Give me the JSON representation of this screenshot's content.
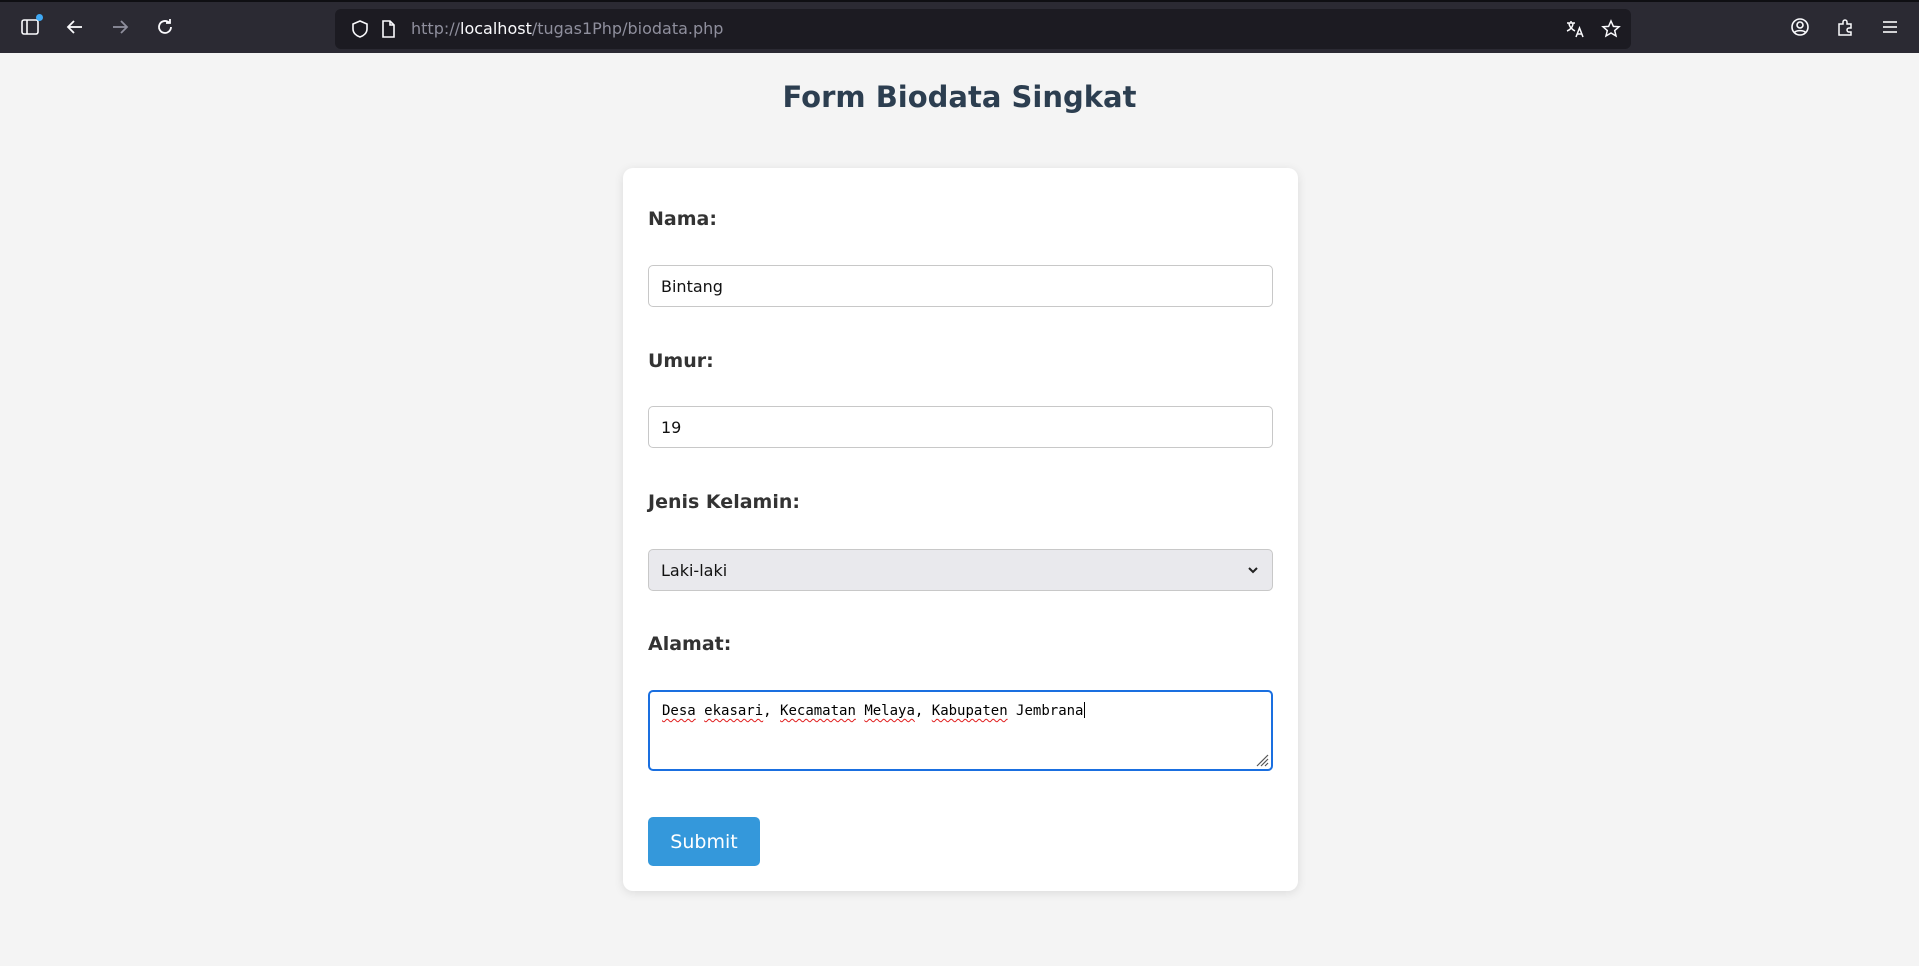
{
  "browser": {
    "url_prefix": "http://",
    "url_host": "localhost",
    "url_path": "/tugas1Php/biodata.php"
  },
  "page": {
    "title": "Form Biodata Singkat"
  },
  "form": {
    "nama_label": "Nama:",
    "nama_value": "Bintang",
    "umur_label": "Umur:",
    "umur_value": "19",
    "jk_label": "Jenis Kelamin:",
    "jk_value": "Laki-laki",
    "alamat_label": "Alamat:",
    "alamat_words": [
      "Desa",
      " ",
      "ekasari",
      ", ",
      "Kecamatan",
      " ",
      "Melaya",
      ", ",
      "Kabupaten",
      " Jembrana"
    ],
    "submit_label": "Submit"
  },
  "colors": {
    "accent": "#3498db",
    "title": "#2c3e50",
    "focus": "#1a6fe0"
  }
}
